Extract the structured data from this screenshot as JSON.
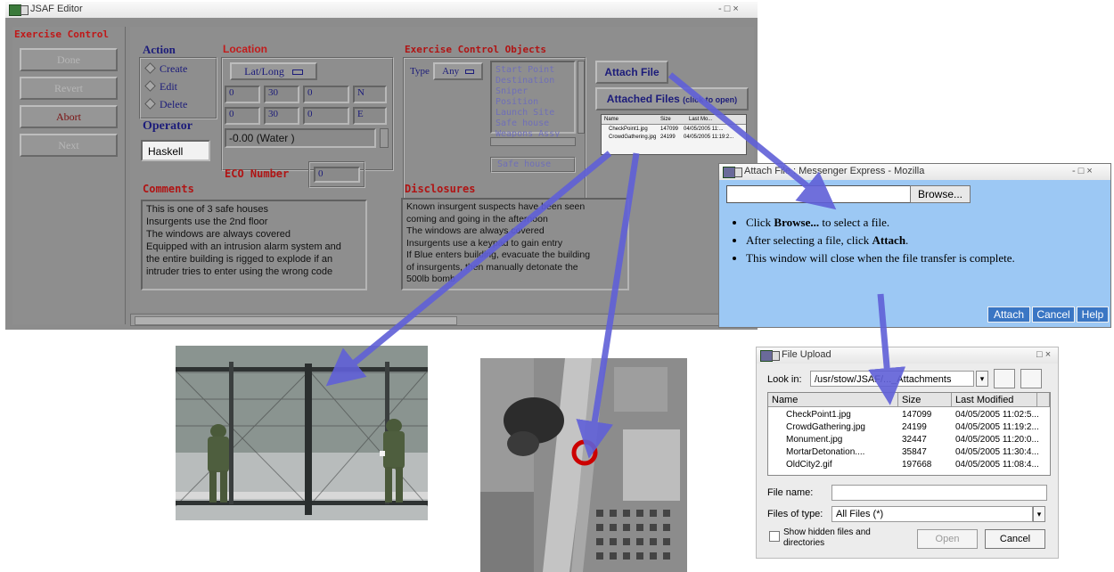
{
  "jsaf": {
    "title": "JSAF Editor",
    "window_controls": "- □ ×",
    "exercise_control": {
      "heading": "Exercise Control",
      "buttons": [
        "Done",
        "Revert",
        "Abort",
        "Next"
      ]
    },
    "action": {
      "heading": "Action",
      "options": [
        "Create",
        "Edit",
        "Delete"
      ],
      "selected": "Create"
    },
    "operator": {
      "heading": "Operator",
      "value": "Haskell"
    },
    "location": {
      "heading": "Location",
      "format": "Lat/Long",
      "lat": [
        "0",
        "30",
        "0",
        "N"
      ],
      "lon": [
        "0",
        "30",
        "0",
        "E"
      ],
      "elevation": "-0.00 (Water         )"
    },
    "eco": {
      "label": "ECO Number",
      "value": "0"
    },
    "eco_objects": {
      "heading": "Exercise Control Objects",
      "type_label": "Type",
      "type_value": "Any",
      "items": [
        "Start Point",
        "Destination",
        "Sniper Position",
        "Launch Site",
        "Safe house",
        "Weapons Assy"
      ],
      "selected_value": "Safe house"
    },
    "attach_file_button": "Attach File",
    "attached_files": {
      "label": "Attached Files",
      "hint": "(click to open)",
      "columns": [
        "Name",
        "Size",
        "Last Mo..."
      ],
      "rows": [
        {
          "name": "CheckPoint1.jpg",
          "size": "147099",
          "modified": "04/05/2005 11:..."
        },
        {
          "name": "CrowdGathering.jpg",
          "size": "24199",
          "modified": "04/05/2005 11:19:2..."
        }
      ]
    },
    "comments": {
      "heading": "Comments",
      "lines": [
        "This is one of 3 safe houses",
        "Insurgents use the 2nd floor",
        "The windows are always covered",
        "Equipped with an intrusion alarm system and",
        "the entire building is rigged to explode if an",
        "intruder tries to enter using the wrong code"
      ]
    },
    "disclosures": {
      "heading": "Disclosures",
      "lines": [
        "Known insurgent suspects have been seen",
        "coming and going in the afternoon",
        "The windows are always covered",
        "Insurgents use a keypad to gain entry",
        "If Blue enters building, evacuate the building",
        "of insurgents, then manually detonate the",
        "500lb bomb"
      ]
    }
  },
  "mozilla": {
    "title": "Attach File : Messenger Express - Mozilla",
    "window_controls": "- □ ×",
    "browse_button": "Browse...",
    "instructions": [
      {
        "pre": "Click ",
        "bold": "Browse...",
        "post": " to select a file."
      },
      {
        "pre": "After selecting a file, click ",
        "bold": "Attach",
        "post": "."
      },
      {
        "pre": "This window will close when the file transfer is complete.",
        "bold": "",
        "post": ""
      }
    ],
    "buttons": [
      "Attach",
      "Cancel",
      "Help"
    ]
  },
  "file_upload": {
    "title": "File Upload",
    "window_controls": "□ ×",
    "look_in_label": "Look in:",
    "look_in_value": "/usr/stow/JSAF/..._Attachments",
    "columns": [
      "Name",
      "Size",
      "Last Modified"
    ],
    "files": [
      {
        "name": "CheckPoint1.jpg",
        "size": "147099",
        "modified": "04/05/2005 11:02:5..."
      },
      {
        "name": "CrowdGathering.jpg",
        "size": "24199",
        "modified": "04/05/2005 11:19:2..."
      },
      {
        "name": "Monument.jpg",
        "size": "32447",
        "modified": "04/05/2005 11:20:0..."
      },
      {
        "name": "MortarDetonation....",
        "size": "35847",
        "modified": "04/05/2005 11:30:4..."
      },
      {
        "name": "OldCity2.gif",
        "size": "197668",
        "modified": "04/05/2005 11:08:4..."
      }
    ],
    "file_name_label": "File name:",
    "file_name_value": "",
    "files_of_type_label": "Files of type:",
    "files_of_type_value": "All Files (*)",
    "show_hidden_label": "Show hidden files and directories",
    "open_button": "Open",
    "cancel_button": "Cancel"
  },
  "colors": {
    "arrow": "#6060d8",
    "jsaf_bg": "#8e8e8e",
    "mozilla_bg": "#9cc8f4",
    "circle": "#cc0000"
  }
}
